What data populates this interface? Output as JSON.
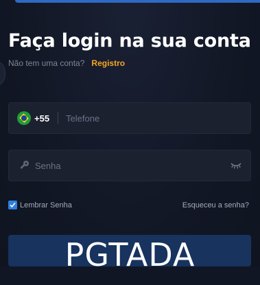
{
  "header": {
    "title": "Faça login na sua conta",
    "no_account": "Não tem uma conta?",
    "register_link": "Registro"
  },
  "phone_field": {
    "country_code": "+55",
    "placeholder": "Telefone",
    "flag_icon": "brazil-flag-icon"
  },
  "password_field": {
    "placeholder": "Senha",
    "icon": "key-icon",
    "toggle_icon": "eye-closed-icon"
  },
  "options": {
    "remember_label": "Lembrar Senha",
    "remember_checked": true,
    "forgot_link": "Esqueceu a senha?"
  },
  "watermark": "PGTADA",
  "colors": {
    "background": "#111622",
    "accent": "#f5a623",
    "button": "#17335e",
    "checkbox": "#2f7fe0"
  }
}
